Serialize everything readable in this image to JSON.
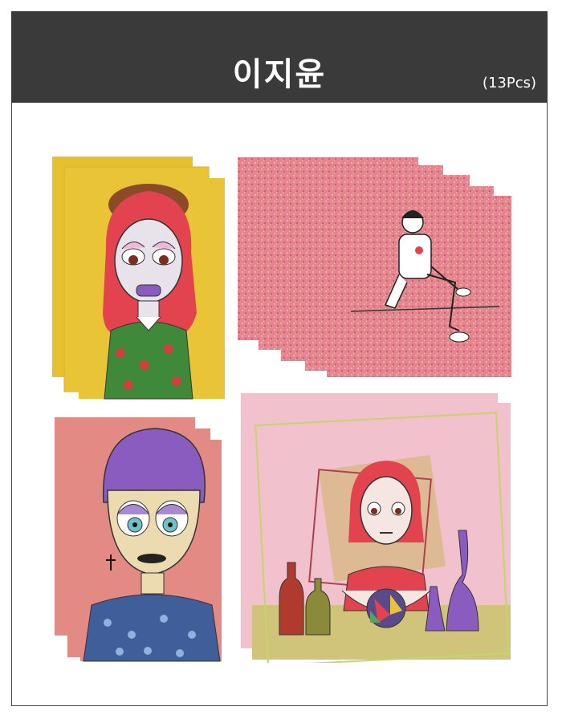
{
  "header": {
    "title": "이지윤",
    "count": "(13Pcs)"
  },
  "colors": {
    "header_bg": "#3a3a3a",
    "card1_bg": "#e6c12f",
    "card2_bg": "#e98b96",
    "card3_bg": "#e48a84",
    "card4_bg": "#f1c1cd"
  },
  "cards": [
    {
      "name": "red-hair-girl-stack"
    },
    {
      "name": "sitting-figure-pink-stack"
    },
    {
      "name": "purple-hair-boy-stack"
    },
    {
      "name": "girl-with-bottles-stack"
    }
  ]
}
